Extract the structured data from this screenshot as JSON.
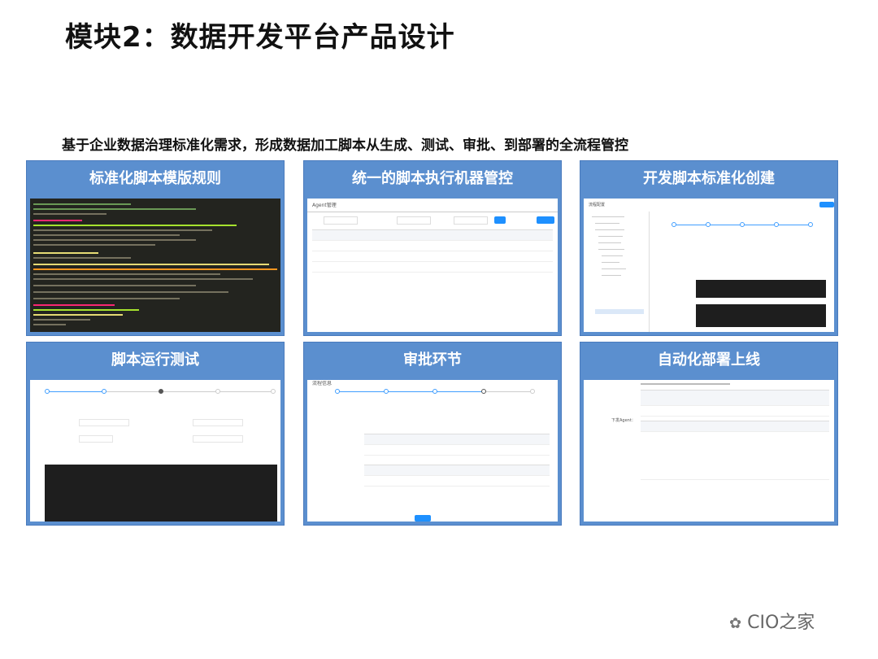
{
  "title": "模块2：数据开发平台产品设计",
  "subtitle": "基于企业数据治理标准化需求，形成数据加工脚本从生成、测试、审批、到部署的全流程管控",
  "panels": [
    {
      "label": "标准化脚本模版规则"
    },
    {
      "label": "统一的脚本执行机器管控",
      "screen_title": "Agent管理"
    },
    {
      "label": "开发脚本标准化创建",
      "screen_title": "流程配置"
    },
    {
      "label": "脚本运行测试"
    },
    {
      "label": "审批环节",
      "screen_title": "流程信息"
    },
    {
      "label": "自动化部署上线",
      "form_label": "下发Agent："
    }
  ],
  "watermark": "CIO之家",
  "colors": {
    "panel_bg": "#5b8fcf",
    "accent": "#409eff",
    "terminal_bg": "#23241f"
  }
}
